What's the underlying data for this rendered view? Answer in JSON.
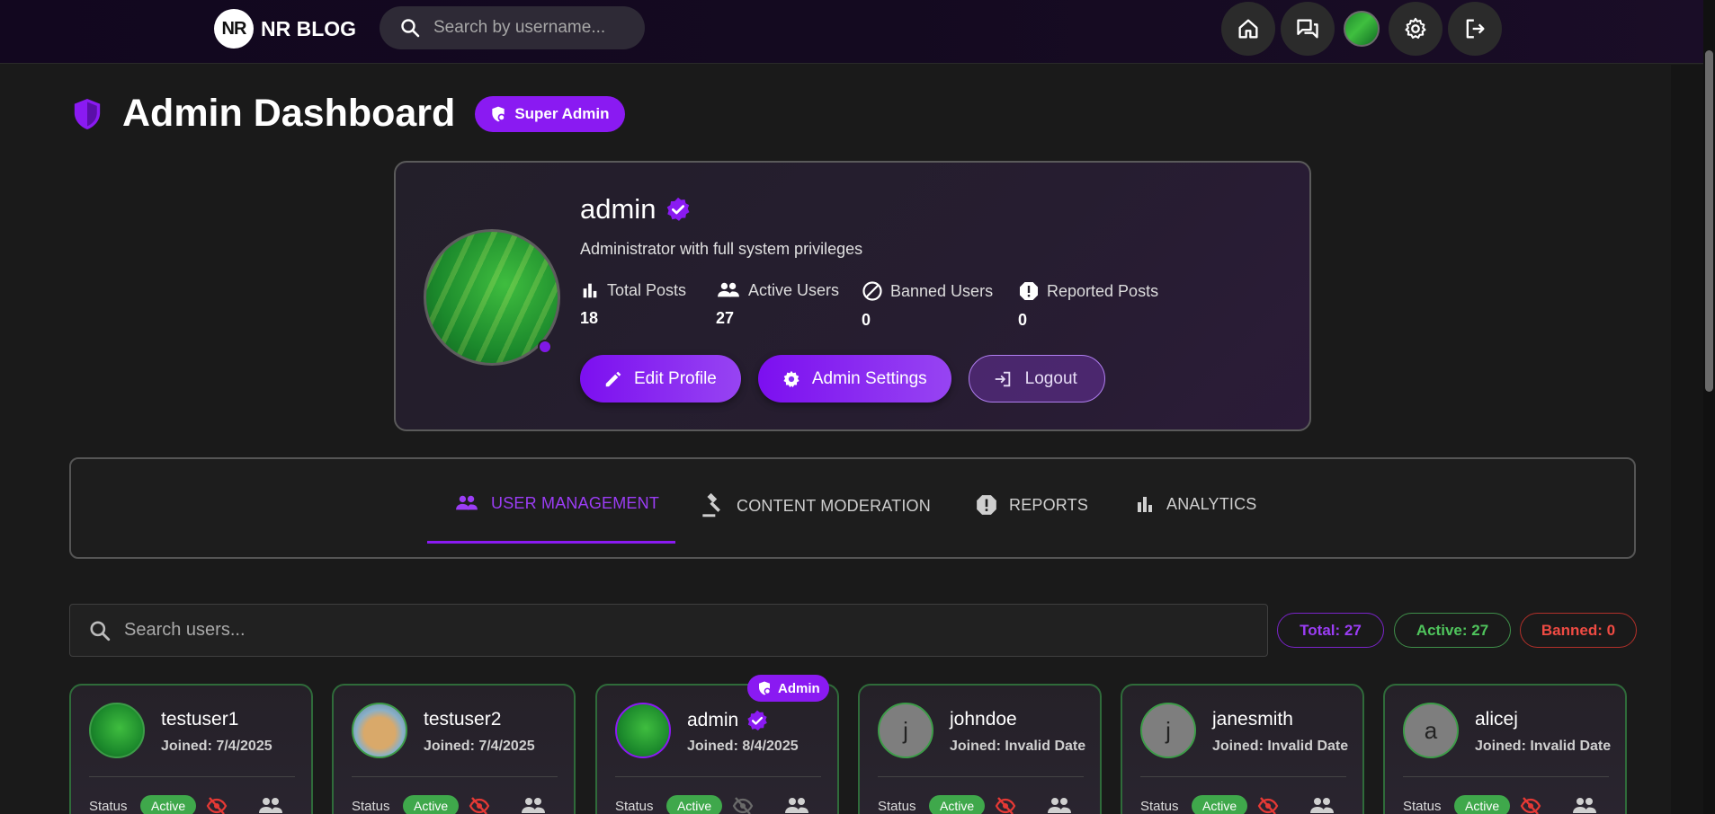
{
  "nav": {
    "logo_initials": "NR",
    "brand": "NR BLOG",
    "search_placeholder": "Search by username...",
    "icons": [
      "home-icon",
      "forum-icon",
      "avatar",
      "gear-icon",
      "logout-icon"
    ]
  },
  "header": {
    "title": "Admin Dashboard",
    "role_badge": "Super Admin"
  },
  "profile": {
    "name": "admin",
    "description": "Administrator with full system privileges",
    "stats": [
      {
        "label": "Total Posts",
        "value": "18",
        "icon": "bar-chart-icon"
      },
      {
        "label": "Active Users",
        "value": "27",
        "icon": "people-icon"
      },
      {
        "label": "Banned Users",
        "value": "0",
        "icon": "block-icon"
      },
      {
        "label": "Reported Posts",
        "value": "0",
        "icon": "alert-icon"
      }
    ],
    "actions": {
      "edit": "Edit Profile",
      "settings": "Admin Settings",
      "logout": "Logout"
    }
  },
  "tabs": [
    {
      "label": "USER MANAGEMENT",
      "active": true
    },
    {
      "label": "CONTENT MODERATION",
      "active": false
    },
    {
      "label": "REPORTS",
      "active": false
    },
    {
      "label": "ANALYTICS",
      "active": false
    }
  ],
  "users_section": {
    "search_placeholder": "Search users...",
    "chips": {
      "total": "Total: 27",
      "active": "Active: 27",
      "banned": "Banned: 0"
    },
    "status_label": "Status",
    "admin_tag": "Admin",
    "users": [
      {
        "username": "testuser1",
        "joined": "Joined: 7/4/2025",
        "status": "Active",
        "avatar": "image-green"
      },
      {
        "username": "testuser2",
        "joined": "Joined: 7/4/2025",
        "status": "Active",
        "avatar": "image-dog"
      },
      {
        "username": "admin",
        "joined": "Joined: 8/4/2025",
        "status": "Active",
        "avatar": "image-green",
        "is_admin": true
      },
      {
        "username": "johndoe",
        "joined": "Joined: Invalid Date",
        "status": "Active",
        "avatar": "j"
      },
      {
        "username": "janesmith",
        "joined": "Joined: Invalid Date",
        "status": "Active",
        "avatar": "j"
      },
      {
        "username": "alicej",
        "joined": "Joined: Invalid Date",
        "status": "Active",
        "avatar": "a"
      }
    ]
  },
  "colors": {
    "accent": "#8a1af2",
    "active": "#3fa84b",
    "banned": "#ef4b43",
    "background": "#1a1a1a"
  }
}
